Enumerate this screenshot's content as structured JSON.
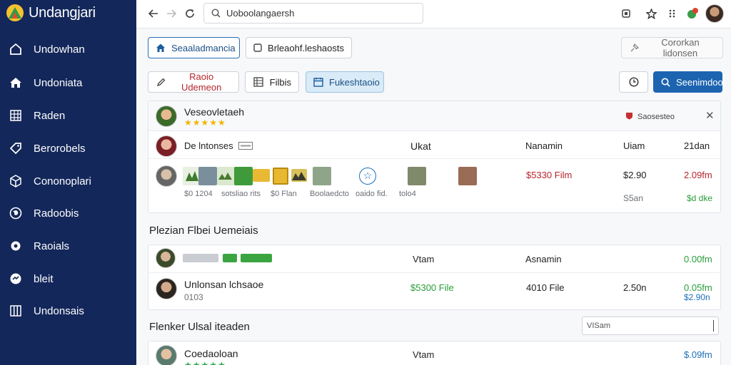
{
  "app": {
    "name": "Undangjari"
  },
  "sidebar": {
    "items": [
      {
        "label": "Undowhan",
        "icon": "home-outline-icon"
      },
      {
        "label": "Undoniata",
        "icon": "home-icon"
      },
      {
        "label": "Raden",
        "icon": "grid-icon"
      },
      {
        "label": "Berorobels",
        "icon": "tag-icon"
      },
      {
        "label": "Cononoplari",
        "icon": "cube-icon"
      },
      {
        "label": "Radoobis",
        "icon": "globe-icon"
      },
      {
        "label": "Raoials",
        "icon": "settings-icon"
      },
      {
        "label": "bleit",
        "icon": "sync-icon"
      },
      {
        "label": "Undonsais",
        "icon": "columns-icon"
      }
    ]
  },
  "browser": {
    "url": "Uoboolangaersh"
  },
  "toolbar": {
    "tab_primary": "Seaaladmancia",
    "tab_secondary": "Brleaohf.leshaosts",
    "search_ghost": "Cororkan lidonsen",
    "action_1": "Raoio Udemeon",
    "action_2": "Filbis",
    "action_3": "Fukeshtaoio",
    "search_button": "Seenimdoor"
  },
  "card1": {
    "title": "Veseovletaeh",
    "rating": "★★★★★",
    "status": "Saosesteo",
    "row1": {
      "label": "De lntonses",
      "col2": "Ukat",
      "col3": "Nanamin",
      "col4": "Uiam",
      "col5": "21dan"
    },
    "row2": {
      "price": "$5330 Film",
      "col4": "$2.90",
      "col5": "2.09fm",
      "sub4": "S5an",
      "sub5": "$d dke",
      "captions": [
        "$0 1204",
        "sotsliao rits",
        "$0 Flan",
        "Boolaedcto",
        "oaido fid.",
        "tolo4"
      ]
    }
  },
  "section2": {
    "title": "Plezian Flbei Uemeiais"
  },
  "card2": {
    "row1": {
      "col2": "Vtam",
      "col3": "Asnamin",
      "col5": "0.00fm"
    },
    "row2": {
      "name": "Unlonsan lchsaoe",
      "sub": "0103",
      "price": "$5300 File",
      "col3": "4010 File",
      "col4": "2.50n",
      "col5": "0.05fm",
      "sub5": "$2.90n"
    }
  },
  "section3": {
    "title": "Flenker Ulsal iteaden",
    "field_value": "VISam"
  },
  "card3": {
    "name": "Coedaoloan",
    "col2": "Vtam",
    "col5": "$.09fm",
    "rating": "★★★★★"
  },
  "colors": {
    "sidebar": "#13275a",
    "primary": "#1d64b0",
    "red": "#b4262c",
    "green": "#2a9d3a"
  }
}
